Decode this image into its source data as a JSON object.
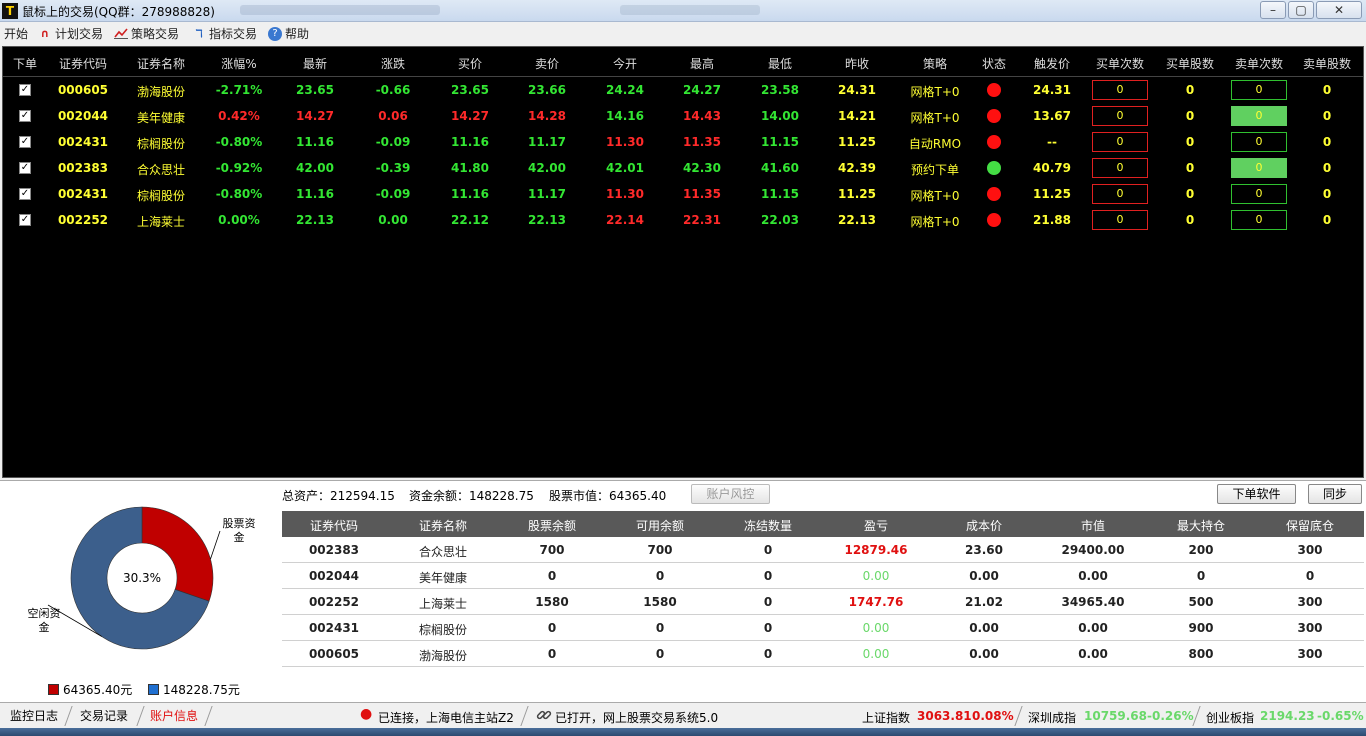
{
  "window": {
    "title": "鼠标上的交易(QQ群：278988828)",
    "minimize": "–",
    "maximize": "▢",
    "close": "✕"
  },
  "menu": {
    "start": "开始",
    "plan_trade": "计划交易",
    "strategy_trade": "策略交易",
    "indicator_trade": "指标交易",
    "help": "帮助"
  },
  "quote_table": {
    "headers": [
      "下单",
      "证券代码",
      "证券名称",
      "涨幅%",
      "最新",
      "涨跌",
      "买价",
      "卖价",
      "今开",
      "最高",
      "最低",
      "昨收",
      "策略",
      "状态",
      "触发价",
      "买单次数",
      "买单股数",
      "卖单次数",
      "卖单股数"
    ],
    "rows": [
      {
        "code": "000605",
        "name": "渤海股份",
        "pct": "-2.71%",
        "last": "23.65",
        "chg": "-0.66",
        "bid": "23.65",
        "ask": "23.66",
        "open": "24.24",
        "high": "24.27",
        "low": "23.58",
        "prev": "24.31",
        "strategy": "网格T+0",
        "status": "red",
        "trigger": "24.31",
        "buy_times": "0",
        "buy_shares": "0",
        "sell_times": "0",
        "sell_shares": "0",
        "sell_fill": false
      },
      {
        "code": "002044",
        "name": "美年健康",
        "pct": "0.42%",
        "last": "14.27",
        "chg": "0.06",
        "bid": "14.27",
        "ask": "14.28",
        "open": "14.16",
        "high": "14.43",
        "low": "14.00",
        "prev": "14.21",
        "strategy": "网格T+0",
        "status": "red",
        "trigger": "13.67",
        "buy_times": "0",
        "buy_shares": "0",
        "sell_times": "0",
        "sell_shares": "0",
        "sell_fill": true
      },
      {
        "code": "002431",
        "name": "棕榈股份",
        "pct": "-0.80%",
        "last": "11.16",
        "chg": "-0.09",
        "bid": "11.16",
        "ask": "11.17",
        "open": "11.30",
        "high": "11.35",
        "low": "11.15",
        "prev": "11.25",
        "strategy": "自动RMO",
        "status": "red",
        "trigger": "--",
        "buy_times": "0",
        "buy_shares": "0",
        "sell_times": "0",
        "sell_shares": "0",
        "sell_fill": false
      },
      {
        "code": "002383",
        "name": "合众思壮",
        "pct": "-0.92%",
        "last": "42.00",
        "chg": "-0.39",
        "bid": "41.80",
        "ask": "42.00",
        "open": "42.01",
        "high": "42.30",
        "low": "41.60",
        "prev": "42.39",
        "strategy": "预约下单",
        "status": "green",
        "trigger": "40.79",
        "buy_times": "0",
        "buy_shares": "0",
        "sell_times": "0",
        "sell_shares": "0",
        "sell_fill": true
      },
      {
        "code": "002431",
        "name": "棕榈股份",
        "pct": "-0.80%",
        "last": "11.16",
        "chg": "-0.09",
        "bid": "11.16",
        "ask": "11.17",
        "open": "11.30",
        "high": "11.35",
        "low": "11.15",
        "prev": "11.25",
        "strategy": "网格T+0",
        "status": "red",
        "trigger": "11.25",
        "buy_times": "0",
        "buy_shares": "0",
        "sell_times": "0",
        "sell_shares": "0",
        "sell_fill": false
      },
      {
        "code": "002252",
        "name": "上海莱士",
        "pct": "0.00%",
        "last": "22.13",
        "chg": "0.00",
        "bid": "22.12",
        "ask": "22.13",
        "open": "22.14",
        "high": "22.31",
        "low": "22.03",
        "prev": "22.13",
        "strategy": "网格T+0",
        "status": "red",
        "trigger": "21.88",
        "buy_times": "0",
        "buy_shares": "0",
        "sell_times": "0",
        "sell_shares": "0",
        "sell_fill": false
      }
    ],
    "colors": {
      "up": "#ff2a2a",
      "down": "#33e633",
      "flat": "#33e633",
      "code": "#ffff33"
    }
  },
  "account": {
    "total_assets": "总资产：212594.15",
    "cash_balance": "资金余额：148228.75",
    "stock_value": "股票市值：64365.40",
    "risk_button": "账户风控",
    "order_button": "下单软件",
    "sync_button": "同步"
  },
  "positions": {
    "headers": [
      "证券代码",
      "证券名称",
      "股票余额",
      "可用余额",
      "冻结数量",
      "盈亏",
      "成本价",
      "市值",
      "最大持仓",
      "保留底仓"
    ],
    "rows": [
      {
        "code": "002383",
        "name": "合众思壮",
        "balance": "700",
        "available": "700",
        "frozen": "0",
        "pnl": "12879.46",
        "pnl_sign": "pos",
        "cost": "23.60",
        "value": "29400.00",
        "max": "200",
        "keep": "300"
      },
      {
        "code": "002044",
        "name": "美年健康",
        "balance": "0",
        "available": "0",
        "frozen": "0",
        "pnl": "0.00",
        "pnl_sign": "zero",
        "cost": "0.00",
        "value": "0.00",
        "max": "0",
        "keep": "0"
      },
      {
        "code": "002252",
        "name": "上海莱士",
        "balance": "1580",
        "available": "1580",
        "frozen": "0",
        "pnl": "1747.76",
        "pnl_sign": "pos",
        "cost": "21.02",
        "value": "34965.40",
        "max": "500",
        "keep": "300"
      },
      {
        "code": "002431",
        "name": "棕榈股份",
        "balance": "0",
        "available": "0",
        "frozen": "0",
        "pnl": "0.00",
        "pnl_sign": "zero",
        "cost": "0.00",
        "value": "0.00",
        "max": "900",
        "keep": "300"
      },
      {
        "code": "000605",
        "name": "渤海股份",
        "balance": "0",
        "available": "0",
        "frozen": "0",
        "pnl": "0.00",
        "pnl_sign": "zero",
        "cost": "0.00",
        "value": "0.00",
        "max": "800",
        "keep": "300"
      }
    ]
  },
  "donut": {
    "center_label": "30.3%",
    "stock_fraction": 0.303,
    "stock_label": "股票资金",
    "idle_label": "空闲资金",
    "stock_color": "#c00000",
    "idle_color": "#3c5f8c",
    "legend_stock": "64365.40元",
    "legend_idle": "148228.75元"
  },
  "statusbar": {
    "tab_log": "监控日志",
    "tab_trades": "交易记录",
    "tab_account": "账户信息",
    "connection": "已连接，上海电信主站Z2",
    "opened": "已打开，网上股票交易系统5.0",
    "sh_name": "上证指数",
    "sh_value": "3063.81",
    "sh_pct": "0.08%",
    "sz_name": "深圳成指",
    "sz_value": "10759.68",
    "sz_pct": "-0.26%",
    "cy_name": "创业板指",
    "cy_value": "2194.23",
    "cy_pct": "-0.65%"
  }
}
